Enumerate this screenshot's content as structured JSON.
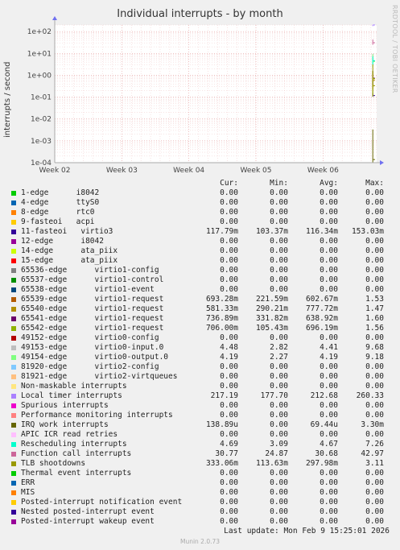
{
  "chart_data": {
    "type": "line",
    "title": "Individual interrupts - by month",
    "ylabel": "interrupts / second",
    "y_scale": "log",
    "ylim": [
      0.0001,
      200
    ],
    "y_ticks": [
      {
        "value": 100,
        "label": "1e+02"
      },
      {
        "value": 10,
        "label": "1e+01"
      },
      {
        "value": 1,
        "label": "1e+00"
      },
      {
        "value": 0.1,
        "label": "1e-01"
      },
      {
        "value": 0.01,
        "label": "1e-02"
      },
      {
        "value": 0.001,
        "label": "1e-03"
      },
      {
        "value": 0.0001,
        "label": "1e-04"
      }
    ],
    "x_ticks": [
      "Week 02",
      "Week 03",
      "Week 04",
      "Week 05",
      "Week 06"
    ],
    "grid": true,
    "legend_position": "bottom",
    "column_headers": [
      "Cur:",
      "Min:",
      "Avg:",
      "Max:"
    ],
    "series": [
      {
        "name": "1-edge      i8042",
        "color": "#00cc00",
        "cur": "0.00",
        "min": "0.00",
        "avg": "0.00",
        "max": "0.00"
      },
      {
        "name": "4-edge      ttyS0",
        "color": "#0066b3",
        "cur": "0.00",
        "min": "0.00",
        "avg": "0.00",
        "max": "0.00"
      },
      {
        "name": "8-edge      rtc0",
        "color": "#ff8000",
        "cur": "0.00",
        "min": "0.00",
        "avg": "0.00",
        "max": "0.00"
      },
      {
        "name": "9-fasteoi   acpi",
        "color": "#ffcc00",
        "cur": "0.00",
        "min": "0.00",
        "avg": "0.00",
        "max": "0.00"
      },
      {
        "name": "11-fasteoi   virtio3",
        "color": "#330099",
        "cur": "117.79m",
        "min": "103.37m",
        "avg": "116.34m",
        "max": "153.03m"
      },
      {
        "name": "12-edge      i8042",
        "color": "#990099",
        "cur": "0.00",
        "min": "0.00",
        "avg": "0.00",
        "max": "0.00"
      },
      {
        "name": "14-edge      ata_piix",
        "color": "#ccff00",
        "cur": "0.00",
        "min": "0.00",
        "avg": "0.00",
        "max": "0.00"
      },
      {
        "name": "15-edge      ata_piix",
        "color": "#ff0000",
        "cur": "0.00",
        "min": "0.00",
        "avg": "0.00",
        "max": "0.00"
      },
      {
        "name": "65536-edge      virtio1-config",
        "color": "#808080",
        "cur": "0.00",
        "min": "0.00",
        "avg": "0.00",
        "max": "0.00"
      },
      {
        "name": "65537-edge      virtio1-control",
        "color": "#008f00",
        "cur": "0.00",
        "min": "0.00",
        "avg": "0.00",
        "max": "0.00"
      },
      {
        "name": "65538-edge      virtio1-event",
        "color": "#00487d",
        "cur": "0.00",
        "min": "0.00",
        "avg": "0.00",
        "max": "0.00"
      },
      {
        "name": "65539-edge      virtio1-request",
        "color": "#b35a00",
        "cur": "693.28m",
        "min": "221.59m",
        "avg": "602.67m",
        "max": "1.53"
      },
      {
        "name": "65540-edge      virtio1-request",
        "color": "#b38f00",
        "cur": "581.33m",
        "min": "290.21m",
        "avg": "777.72m",
        "max": "1.47"
      },
      {
        "name": "65541-edge      virtio1-request",
        "color": "#6b006b",
        "cur": "736.89m",
        "min": "331.82m",
        "avg": "638.92m",
        "max": "1.60"
      },
      {
        "name": "65542-edge      virtio1-request",
        "color": "#8fb300",
        "cur": "706.00m",
        "min": "105.43m",
        "avg": "696.19m",
        "max": "1.56"
      },
      {
        "name": "49152-edge      virtio0-config",
        "color": "#b30000",
        "cur": "0.00",
        "min": "0.00",
        "avg": "0.00",
        "max": "0.00"
      },
      {
        "name": "49153-edge      virtio0-input.0",
        "color": "#bebebe",
        "cur": "4.48",
        "min": "2.82",
        "avg": "4.41",
        "max": "9.68"
      },
      {
        "name": "49154-edge      virtio0-output.0",
        "color": "#80ff80",
        "cur": "4.19",
        "min": "2.27",
        "avg": "4.19",
        "max": "9.18"
      },
      {
        "name": "81920-edge      virtio2-config",
        "color": "#80c9ff",
        "cur": "0.00",
        "min": "0.00",
        "avg": "0.00",
        "max": "0.00"
      },
      {
        "name": "81921-edge      virtio2-virtqueues",
        "color": "#ffc080",
        "cur": "0.00",
        "min": "0.00",
        "avg": "0.00",
        "max": "0.00"
      },
      {
        "name": "Non-maskable interrupts",
        "color": "#ffe680",
        "cur": "0.00",
        "min": "0.00",
        "avg": "0.00",
        "max": "0.00"
      },
      {
        "name": "Local timer interrupts",
        "color": "#aa80ff",
        "cur": "217.19",
        "min": "177.70",
        "avg": "212.68",
        "max": "260.33"
      },
      {
        "name": "Spurious interrupts",
        "color": "#ee00cc",
        "cur": "0.00",
        "min": "0.00",
        "avg": "0.00",
        "max": "0.00"
      },
      {
        "name": "Performance monitoring interrupts",
        "color": "#ff8080",
        "cur": "0.00",
        "min": "0.00",
        "avg": "0.00",
        "max": "0.00"
      },
      {
        "name": "IRQ work interrupts",
        "color": "#666600",
        "cur": "138.89u",
        "min": "0.00",
        "avg": "69.44u",
        "max": "3.30m"
      },
      {
        "name": "APIC ICR read retries",
        "color": "#ffbfff",
        "cur": "0.00",
        "min": "0.00",
        "avg": "0.00",
        "max": "0.00"
      },
      {
        "name": "Rescheduling interrupts",
        "color": "#00ffcc",
        "cur": "4.69",
        "min": "3.09",
        "avg": "4.67",
        "max": "7.26"
      },
      {
        "name": "Function call interrupts",
        "color": "#cc6699",
        "cur": "30.77",
        "min": "24.87",
        "avg": "30.68",
        "max": "42.97"
      },
      {
        "name": "TLB shootdowns",
        "color": "#999900",
        "cur": "333.06m",
        "min": "113.63m",
        "avg": "297.98m",
        "max": "3.11"
      },
      {
        "name": "Thermal event interrupts",
        "color": "#00cc00",
        "cur": "0.00",
        "min": "0.00",
        "avg": "0.00",
        "max": "0.00"
      },
      {
        "name": "ERR",
        "color": "#0066b3",
        "cur": "0.00",
        "min": "0.00",
        "avg": "0.00",
        "max": "0.00"
      },
      {
        "name": "MIS",
        "color": "#ff8000",
        "cur": "0.00",
        "min": "0.00",
        "avg": "0.00",
        "max": "0.00"
      },
      {
        "name": "Posted-interrupt notification event",
        "color": "#ffcc00",
        "cur": "0.00",
        "min": "0.00",
        "avg": "0.00",
        "max": "0.00"
      },
      {
        "name": "Nested posted-interrupt event",
        "color": "#330099",
        "cur": "0.00",
        "min": "0.00",
        "avg": "0.00",
        "max": "0.00"
      },
      {
        "name": "Posted-interrupt wakeup event",
        "color": "#990099",
        "cur": "0.00",
        "min": "0.00",
        "avg": "0.00",
        "max": "0.00"
      }
    ]
  },
  "footer": {
    "last_update": "Last update: Mon Feb  9 15:25:01 2026",
    "munin_version": "Munin 2.0.73",
    "rrdtool_credit": "RRDTOOL / TOBI OETIKER"
  }
}
